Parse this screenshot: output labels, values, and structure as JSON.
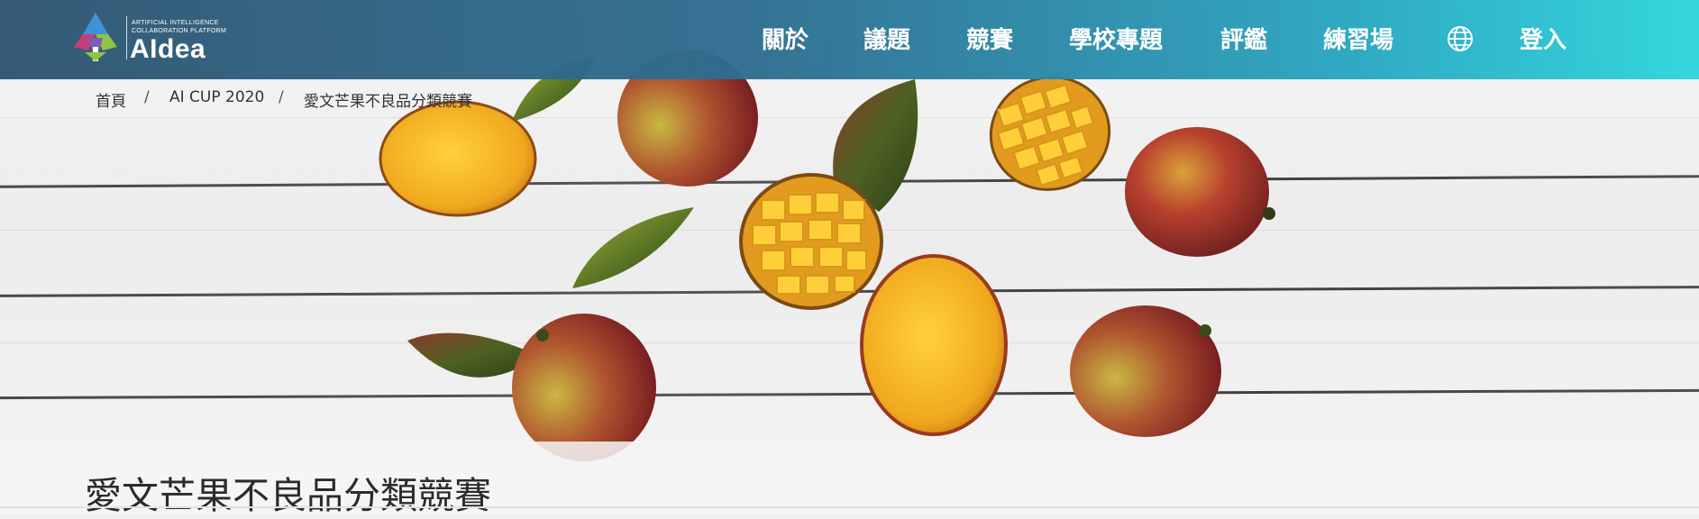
{
  "logo": {
    "tagline_line1": "ARTIFICIAL INTELLIGENCE",
    "tagline_line2": "COLLABORATION PLATFORM",
    "wordmark": "AIdea"
  },
  "nav": {
    "items": [
      {
        "label": "關於"
      },
      {
        "label": "議題"
      },
      {
        "label": "競賽"
      },
      {
        "label": "學校專題"
      },
      {
        "label": "評鑑"
      },
      {
        "label": "練習場"
      }
    ],
    "language_icon": "globe-icon",
    "login_label": "登入"
  },
  "breadcrumb": {
    "items": [
      "首頁",
      "AI CUP 2020",
      "愛文芒果不良品分類競賽"
    ],
    "separator": "/"
  },
  "page": {
    "title": "愛文芒果不良品分類競賽"
  },
  "colors": {
    "topbar_start": "#2f5672",
    "topbar_end": "#2ed6dc",
    "mango_yellow": "#f2b62a",
    "mango_red": "#9e2b2b",
    "leaf_green": "#6b8a2e"
  }
}
